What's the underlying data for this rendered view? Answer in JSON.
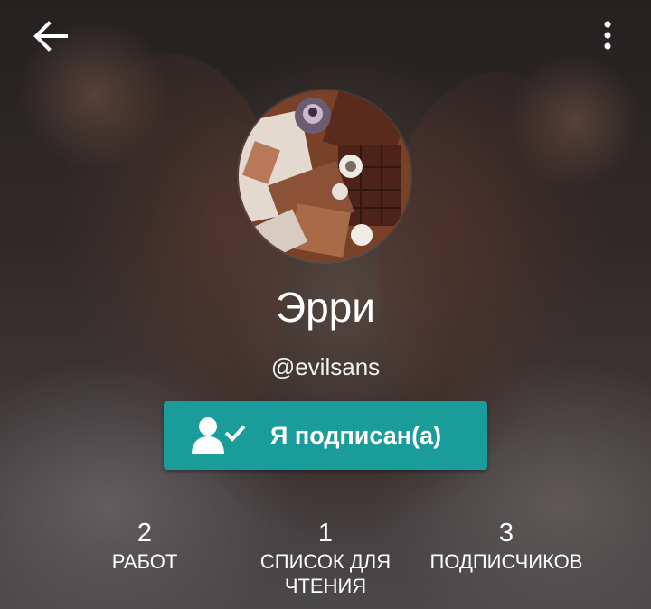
{
  "header": {
    "back_icon": "arrow-left-icon",
    "menu_icon": "more-vertical-icon"
  },
  "profile": {
    "name": "Эрри",
    "handle": "@evilsans",
    "avatar": "avatar-image"
  },
  "follow_button": {
    "label": "Я подписан(а)",
    "icon": "user-check-icon",
    "color": "#199c9a"
  },
  "stats": {
    "works": {
      "count": "2",
      "label": "РАБОТ"
    },
    "reading_list": {
      "count": "1",
      "label_line1": "СПИСОК ДЛЯ",
      "label_line2": "ЧТЕНИЯ"
    },
    "followers": {
      "count": "3",
      "label": "ПОДПИСЧИКОВ"
    }
  }
}
